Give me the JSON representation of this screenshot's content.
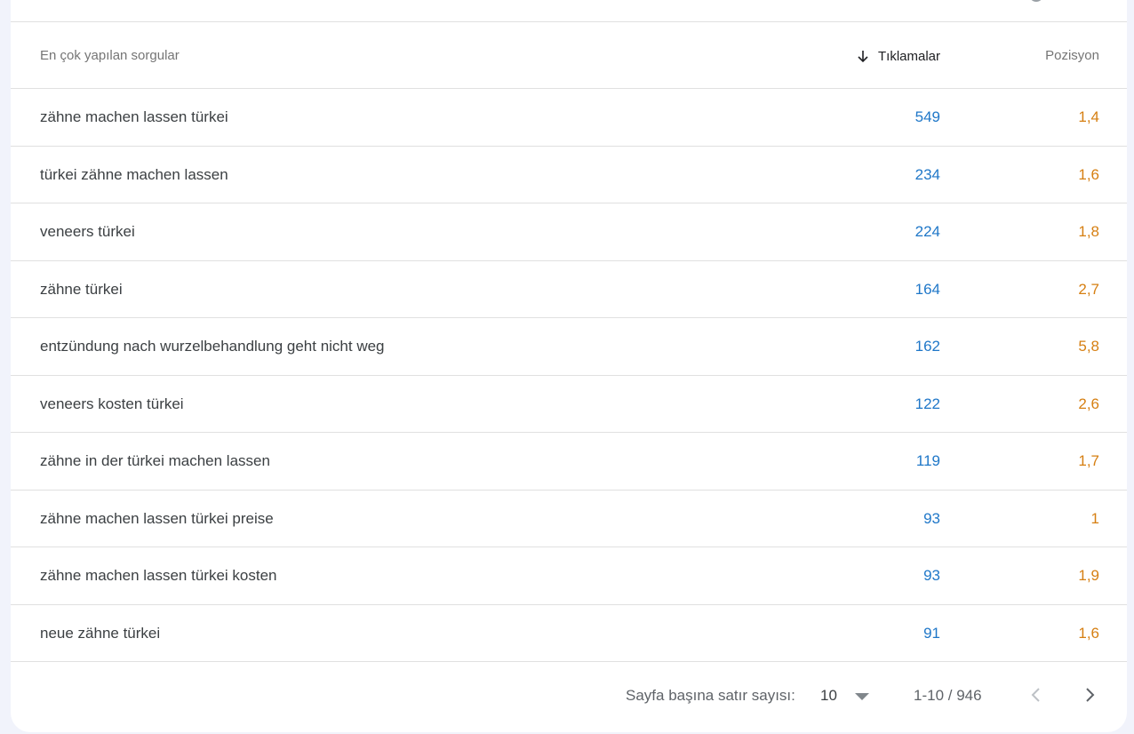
{
  "table": {
    "headers": {
      "query": "En çok yapılan sorgular",
      "clicks": "Tıklamalar",
      "position": "Pozisyon"
    },
    "sort_icon": "arrow-down-icon",
    "rows": [
      {
        "query": "zähne machen lassen türkei",
        "clicks": "549",
        "position": "1,4"
      },
      {
        "query": "türkei zähne machen lassen",
        "clicks": "234",
        "position": "1,6"
      },
      {
        "query": "veneers türkei",
        "clicks": "224",
        "position": "1,8"
      },
      {
        "query": "zähne türkei",
        "clicks": "164",
        "position": "2,7"
      },
      {
        "query": "entzündung nach wurzelbehandlung geht nicht weg",
        "clicks": "162",
        "position": "5,8"
      },
      {
        "query": "veneers kosten türkei",
        "clicks": "122",
        "position": "2,6"
      },
      {
        "query": "zähne in der türkei machen lassen",
        "clicks": "119",
        "position": "1,7"
      },
      {
        "query": "zähne machen lassen türkei preise",
        "clicks": "93",
        "position": "1"
      },
      {
        "query": "zähne machen lassen türkei kosten",
        "clicks": "93",
        "position": "1,9"
      },
      {
        "query": "neue zähne türkei",
        "clicks": "91",
        "position": "1,6"
      }
    ]
  },
  "pagination": {
    "rows_per_page_label": "Sayfa başına satır sayısı:",
    "rows_per_page_value": "10",
    "range": "1-10 / 946",
    "prev_icon": "chevron-left-icon",
    "next_icon": "chevron-right-icon"
  },
  "colors": {
    "clicks": "#1f77c8",
    "position": "#d67f12",
    "background": "#f1f3fb"
  }
}
